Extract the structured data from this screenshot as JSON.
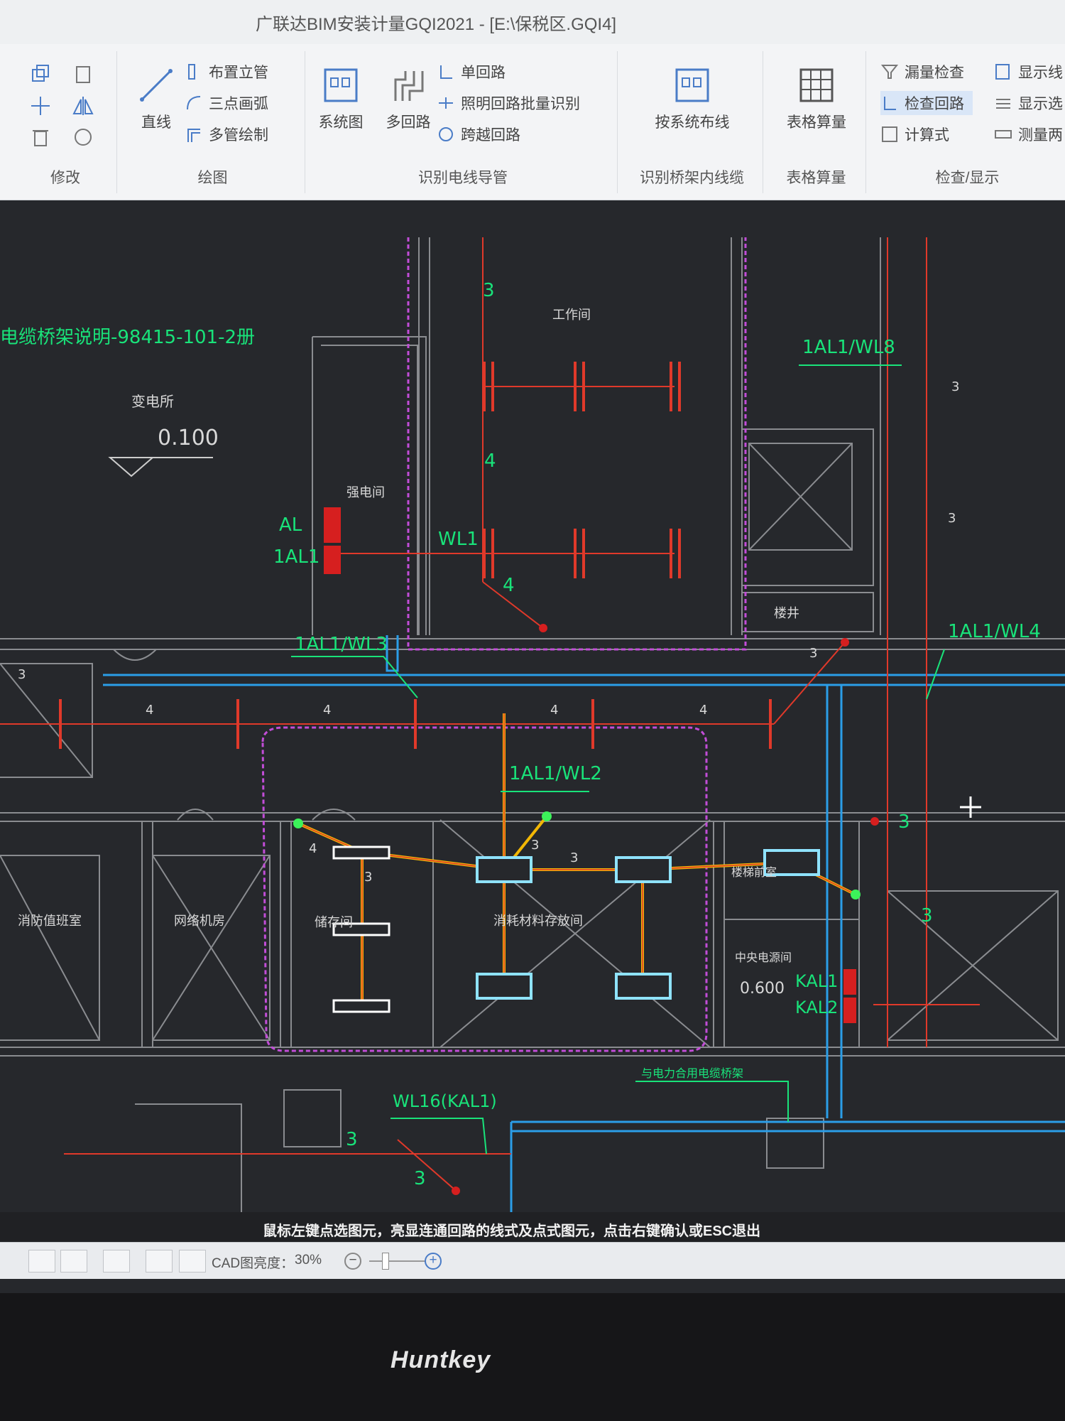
{
  "window": {
    "title": "广联达BIM安装计量GQI2021 - [E:\\保税区.GQI4]"
  },
  "ribbon": {
    "modify": {
      "title": "修改"
    },
    "draw": {
      "title": "绘图",
      "line": "直线",
      "riser": "布置立管",
      "arc": "三点画弧",
      "multi_pipe": "多管绘制"
    },
    "wire": {
      "title": "识别电线导管",
      "system": "系统图",
      "multi_circuit": "多回路",
      "single_circuit": "单回路",
      "batch": "照明回路批量识别",
      "skip": "跨越回路"
    },
    "tray": {
      "title": "识别桥架内线缆",
      "by_system": "按系统布线"
    },
    "table": {
      "title": "表格算量",
      "label": "表格算量"
    },
    "check": {
      "title": "检查/显示",
      "missing": "漏量检查",
      "circuit": "检查回路",
      "formula": "计算式",
      "show_line": "显示线",
      "show_sel": "显示选",
      "measure": "测量两"
    }
  },
  "cad": {
    "labels": {
      "drawing_no": "电缆桥架说明-98415-101-2册",
      "substation": "变电所",
      "elevation_1": "0.100",
      "strong_room": "强电间",
      "al": "AL",
      "al1": "1AL1",
      "wl1": "WL1",
      "wl3": "1AL1/WL3",
      "wl8": "1AL1/WL8",
      "wl4": "1AL1/WL4",
      "wl2": "1AL1/WL2",
      "wl16": "WL16(KAL1)",
      "kal1": "KAL1",
      "kal2": "KAL2",
      "workroom": "工作间",
      "stair": "楼井",
      "fire_control": "消防值班室",
      "network": "网络机房",
      "storage": "储存间",
      "materials": "消耗材料存放间",
      "medium_room": "中央电源间",
      "corridor": "楼梯前室",
      "elevation_2": "0.600",
      "tray_note": "与电力合用电缆桥架",
      "n3": "3",
      "n4": "4"
    }
  },
  "prompt": {
    "text": "鼠标左键点选图元，亮显连通回路的线式及点式图元，点击右键确认或ESC退出"
  },
  "statusbar": {
    "brightness_label": "CAD图亮度：",
    "brightness_value": "30%"
  },
  "monitor": {
    "brand": "Huntkey"
  }
}
